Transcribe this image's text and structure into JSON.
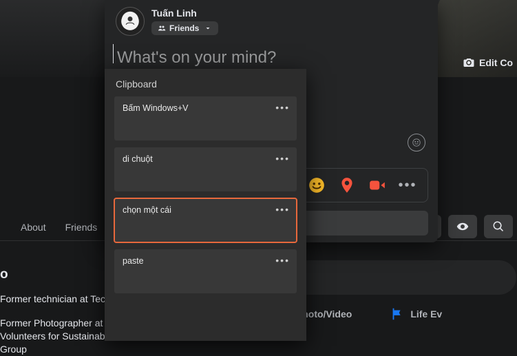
{
  "cover": {
    "edit_label": "Edit Co"
  },
  "tabs": {
    "about": "About",
    "friends": "Friends"
  },
  "intro": {
    "title": "o",
    "line1": "Former technician at Teco",
    "line2": "Former Photographer at C\nVolunteers for Sustainabl\nGroup"
  },
  "bg": {
    "composer_placeholder": "s on your mind?",
    "attach_video": "deo",
    "attach_photo": "Photo/Video",
    "attach_life": "Life Ev"
  },
  "composer": {
    "user_name": "Tuấn Linh",
    "audience_label": "Friends",
    "placeholder": "What's on your mind?"
  },
  "clipboard": {
    "title": "Clipboard",
    "items": [
      {
        "text": "Bấm Windows+V",
        "selected": false
      },
      {
        "text": "di chuột",
        "selected": false
      },
      {
        "text": "chọn một cái",
        "selected": true
      },
      {
        "text": "paste",
        "selected": false
      }
    ]
  }
}
